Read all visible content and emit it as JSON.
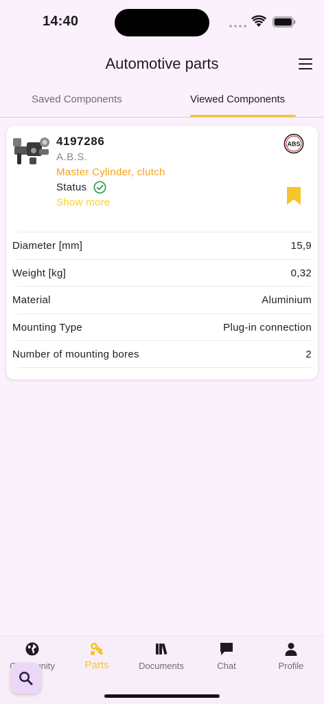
{
  "status_bar": {
    "time": "14:40"
  },
  "app_bar": {
    "title": "Automotive parts",
    "menu_icon": "hamburger-menu-icon"
  },
  "tabs": [
    {
      "label": "Saved Components",
      "selected": false
    },
    {
      "label": "Viewed Components",
      "selected": true
    }
  ],
  "part": {
    "number": "4197286",
    "brand": "A.B.S.",
    "brand_logo_text": "ABS",
    "category": "Master Cylinder, clutch",
    "status_label": "Status",
    "show_more": "Show more",
    "bookmarked": true,
    "specs": [
      {
        "name": "Diameter [mm]",
        "value": "15,9"
      },
      {
        "name": "Weight [kg]",
        "value": "0,32"
      },
      {
        "name": "Material",
        "value": "Aluminium"
      },
      {
        "name": "Mounting Type",
        "value": "Plug-in connection"
      },
      {
        "name": "Number of mounting bores",
        "value": "2"
      }
    ]
  },
  "bottom_nav": [
    {
      "label": "Community",
      "icon": "globe-icon",
      "active": false
    },
    {
      "label": "Parts",
      "icon": "parts-icon",
      "active": true
    },
    {
      "label": "Documents",
      "icon": "books-icon",
      "active": false
    },
    {
      "label": "Chat",
      "icon": "chat-bubble-icon",
      "active": false
    },
    {
      "label": "Profile",
      "icon": "person-icon",
      "active": false
    }
  ],
  "fab": {
    "icon": "search-icon"
  },
  "colors": {
    "background": "#fbf1fc",
    "accent": "#f6c52c",
    "category": "#f4a21a",
    "status_ok": "#2e9e4f"
  }
}
